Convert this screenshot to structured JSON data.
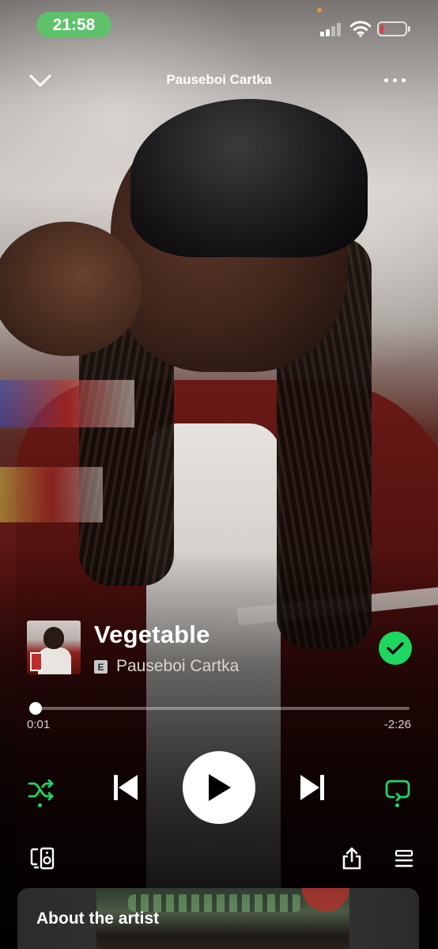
{
  "status_bar": {
    "time": "21:58",
    "battery_level": 0.12,
    "battery_color": "#e23b3b",
    "time_pill_color": "#5ec26a"
  },
  "header": {
    "title": "Pauseboi Cartka",
    "collapse_icon": "chevron-down-icon",
    "more_icon": "more-horizontal-icon"
  },
  "track": {
    "title": "Vegetable",
    "explicit_badge": "E",
    "artist": "Pauseboi Cartka",
    "liked": true,
    "liked_color": "#1ed760"
  },
  "progress": {
    "elapsed": "0:01",
    "remaining": "-2:26",
    "fraction": 0.007
  },
  "controls": {
    "shuffle_icon": "shuffle-icon",
    "shuffle_active": true,
    "previous_icon": "skip-previous-icon",
    "play_icon": "play-icon",
    "next_icon": "skip-next-icon",
    "repeat_icon": "repeat-icon",
    "repeat_active": true,
    "accent_color": "#1ed760"
  },
  "bottom_bar": {
    "devices_icon": "connect-devices-icon",
    "share_icon": "share-icon",
    "queue_icon": "queue-icon"
  },
  "about_artist": {
    "title": "About the artist"
  }
}
